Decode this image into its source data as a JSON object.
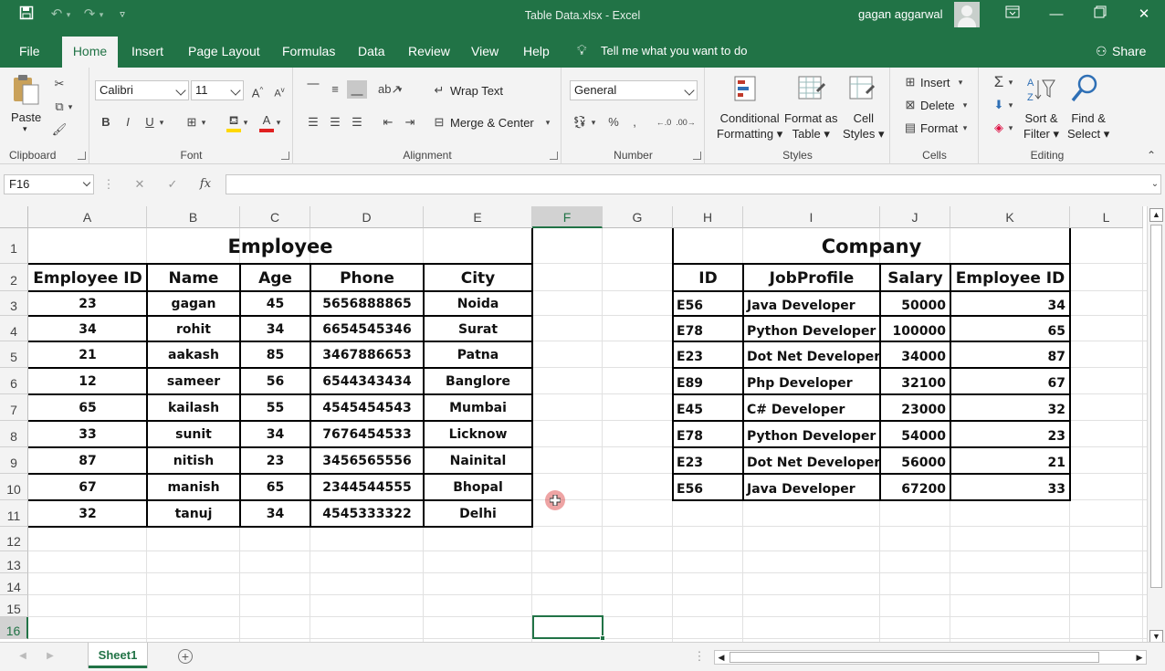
{
  "window": {
    "title": "Table Data.xlsx  -  Excel",
    "user": "gagan aggarwal",
    "qat": {
      "save_icon": "save-icon",
      "undo_icon": "undo-icon",
      "redo_icon": "redo-icon"
    }
  },
  "tabs": [
    "File",
    "Home",
    "Insert",
    "Page Layout",
    "Formulas",
    "Data",
    "Review",
    "View",
    "Help"
  ],
  "tell_me": "Tell me what you want to do",
  "share": "Share",
  "ribbon": {
    "clipboard": {
      "label": "Clipboard",
      "paste": "Paste"
    },
    "font": {
      "label": "Font",
      "name": "Calibri",
      "size": "11",
      "bold": "B",
      "italic": "I",
      "underline": "U"
    },
    "alignment": {
      "label": "Alignment",
      "wrap": "Wrap Text",
      "merge": "Merge & Center"
    },
    "number": {
      "label": "Number",
      "format": "General"
    },
    "styles": {
      "label": "Styles",
      "cond1": "Conditional",
      "cond2": "Formatting",
      "fmt1": "Format as",
      "fmt2": "Table",
      "cell1": "Cell",
      "cell2": "Styles"
    },
    "cells": {
      "label": "Cells",
      "insert": "Insert",
      "delete": "Delete",
      "format": "Format"
    },
    "editing": {
      "label": "Editing",
      "sort1": "Sort &",
      "sort2": "Filter",
      "find1": "Find &",
      "find2": "Select"
    }
  },
  "formula_bar": {
    "name_box": "F16",
    "fx": "fx",
    "value": ""
  },
  "columns": [
    "A",
    "B",
    "C",
    "D",
    "E",
    "F",
    "G",
    "H",
    "I",
    "J",
    "K",
    "L"
  ],
  "rows": [
    "1",
    "2",
    "3",
    "4",
    "5",
    "6",
    "7",
    "8",
    "9",
    "10",
    "11",
    "12",
    "13",
    "14",
    "15",
    "16"
  ],
  "employee": {
    "title": "Employee",
    "headers": [
      "Employee ID",
      "Name",
      "Age",
      "Phone",
      "City"
    ],
    "rows": [
      [
        "23",
        "gagan",
        "45",
        "5656888865",
        "Noida"
      ],
      [
        "34",
        "rohit",
        "34",
        "6654545346",
        "Surat"
      ],
      [
        "21",
        "aakash",
        "85",
        "3467886653",
        "Patna"
      ],
      [
        "12",
        "sameer",
        "56",
        "6544343434",
        "Banglore"
      ],
      [
        "65",
        "kailash",
        "55",
        "4545454543",
        "Mumbai"
      ],
      [
        "33",
        "sunit",
        "34",
        "7676454533",
        "Licknow"
      ],
      [
        "87",
        "nitish",
        "23",
        "3456565556",
        "Nainital"
      ],
      [
        "67",
        "manish",
        "65",
        "2344544555",
        "Bhopal"
      ],
      [
        "32",
        "tanuj",
        "34",
        "4545333322",
        "Delhi"
      ]
    ]
  },
  "company": {
    "title": "Company",
    "headers": [
      "ID",
      "JobProfile",
      "Salary",
      "Employee ID"
    ],
    "rows": [
      [
        "E56",
        "Java Developer",
        "50000",
        "34"
      ],
      [
        "E78",
        "Python Developer",
        "100000",
        "65"
      ],
      [
        "E23",
        "Dot Net Developer",
        "34000",
        "87"
      ],
      [
        "E89",
        "Php Developer",
        "32100",
        "67"
      ],
      [
        "E45",
        "C# Developer",
        "23000",
        "32"
      ],
      [
        "E78",
        "Python Developer",
        "54000",
        "23"
      ],
      [
        "E23",
        "Dot Net Developer",
        "56000",
        "21"
      ],
      [
        "E56",
        "Java Developer",
        "67200",
        "33"
      ]
    ]
  },
  "sheet_tab": "Sheet1",
  "colors": {
    "accent": "#217346",
    "selection": "#217346",
    "cursor": "#e05a5a"
  }
}
